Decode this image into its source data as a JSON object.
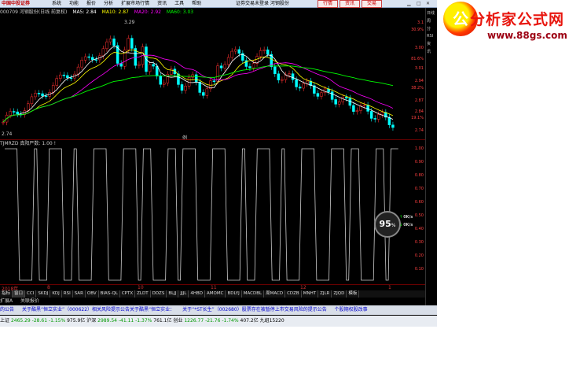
{
  "titlebar": {
    "brand": "中国中投证券",
    "menu": [
      "系统",
      "功能",
      "报价",
      "分析",
      "扩展市场行情",
      "资讯",
      "工具",
      "帮助"
    ],
    "center": "证券交易未登录  河钢股份",
    "buttons": [
      "行情",
      "资讯",
      "交易"
    ]
  },
  "infobar": {
    "code_name": "000709 河钢股份(日线 前复权)",
    "ma5": "MA5: 2.84",
    "ma10": "MA10: 2.87",
    "ma20": "MA20: 2.92",
    "ma60": "MA60: 3.03"
  },
  "main_axis": [
    "3.1",
    "30.9%",
    "3.00",
    "81.6%",
    "3.01",
    "2.94",
    "38.2%",
    "2.87",
    "2.84",
    "19.1%",
    "2.74"
  ],
  "main_chart_labels": {
    "high_mark": "3.29",
    "low_mark": "2.74",
    "cursor": "例"
  },
  "colors": {
    "ma5": "#ffffff",
    "ma10": "#ffff00",
    "ma20": "#ff00ff",
    "ma60": "#00ff00",
    "up": "#ff3030",
    "down": "#00ffff",
    "indicator": "#cccccc",
    "axis": "#ff4040"
  },
  "sub_indicator": {
    "header": "TJMRZD 真阳严数: 1.00 !"
  },
  "sub_axis": [
    "1.00",
    "0.90",
    "0.80",
    "0.70",
    "0.60",
    "0.50",
    "0.40",
    "0.30",
    "0.20",
    "0.10"
  ],
  "datebar": {
    "start": "2018年",
    "ticks": [
      "8",
      "10",
      "11",
      "12",
      "1"
    ]
  },
  "tabs": [
    "指标",
    "窗口",
    "CCI",
    "SKDJ",
    "KDJ",
    "RSI",
    "SAR",
    "OBV",
    "BIAS-QL",
    "CPTX",
    "ZLDT",
    "DDZS",
    "BLJJ",
    "JJJL",
    "4HBD",
    "AMOMC",
    "BDLYJ",
    "MACDBL",
    "周MACD",
    "CDZB",
    "MNHT",
    "ZJLR",
    "ZJQD",
    "模板"
  ],
  "bottom_tabs": [
    "扩展A",
    "关联报价"
  ],
  "ticker": [
    "的公告",
    "关于酷黑“恒立实业”（000622）相关风险提示公告关于酷黑“恒立实业：",
    "关于“*ST长生”（002680）股票存在被暂停上市交易风险的提示公告",
    "个股期权股改事"
  ],
  "status": {
    "sh_label": "上证",
    "sh": "2465.29",
    "sh_chg": "-28.61",
    "sh_pct": "-1.15%",
    "sh_amt": "975.9亿",
    "sz_label": "沪深",
    "sz": "2989.54",
    "sz_chg": "-41.11",
    "sz_pct": "-1.37%",
    "sz_amt": "761.1亿",
    "cy_label": "创业",
    "cy": "1226.77",
    "cy_chg": "-21.76",
    "cy_pct": "-1.74%",
    "cy_amt": "407.2亿",
    "server": "九组15220"
  },
  "sidebar": [
    "日线",
    "周",
    "分",
    "RSI",
    "资",
    "讯"
  ],
  "gauge": {
    "value": "95",
    "unit": "%"
  },
  "netspeed": [
    {
      "arrow": "↑",
      "value": "0K/s"
    },
    {
      "arrow": "↓",
      "value": "0K/s"
    }
  ],
  "watermark": {
    "title": "分析家公式网",
    "url": "www.88gs.com",
    "badge": "公"
  }
}
